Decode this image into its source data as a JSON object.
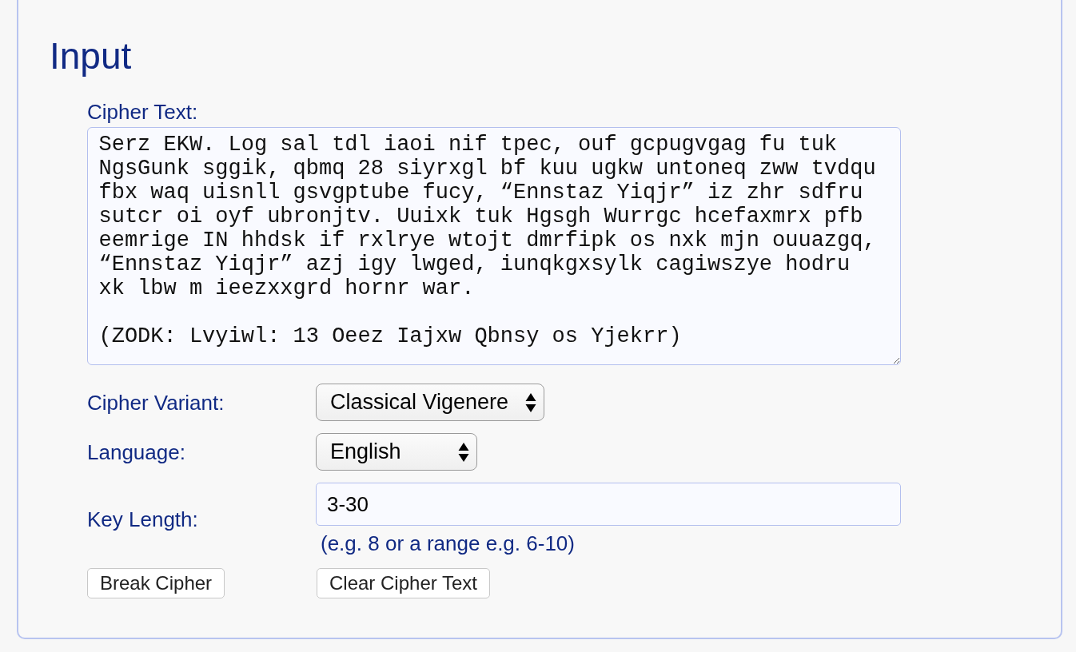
{
  "panel": {
    "title": "Input"
  },
  "cipher_text": {
    "label": "Cipher Text:",
    "value": "Serz EKW. Log sal tdl iaoi nif tpec, ouf gcpugvgag fu tuk NgsGunk sggik, qbmq 28 siyrxgl bf kuu ugkw untoneq zww tvdqu fbx waq uisnll gsvgptube fucy, “Ennstaz Yiqjr” iz zhr sdfru sutcr oi oyf ubronjtv. Uuixk tuk Hgsgh Wurrgc hcefaxmrx pfb eemrige IN hhdsk if rxlrye wtojt dmrfipk os nxk mjn ouuazgq, “Ennstaz Yiqjr” azj igy lwged, iunqkgxsylk cagiwszye hodru xk lbw m ieezxxgrd hornr war.\n\n(ZODK: Lvyiwl: 13 Oeez Iajxw Qbnsy os Yjekrr)"
  },
  "fields": [
    {
      "kind": "select",
      "label": "Cipher Variant:",
      "value": "Classical Vigenere"
    },
    {
      "kind": "select",
      "label": "Language:",
      "value": "English"
    },
    {
      "kind": "input",
      "label": "Key Length:",
      "value": "3-30",
      "hint": "(e.g. 8 or a range e.g. 6-10)"
    }
  ],
  "buttons": [
    "Break Cipher",
    "Clear Cipher Text"
  ]
}
